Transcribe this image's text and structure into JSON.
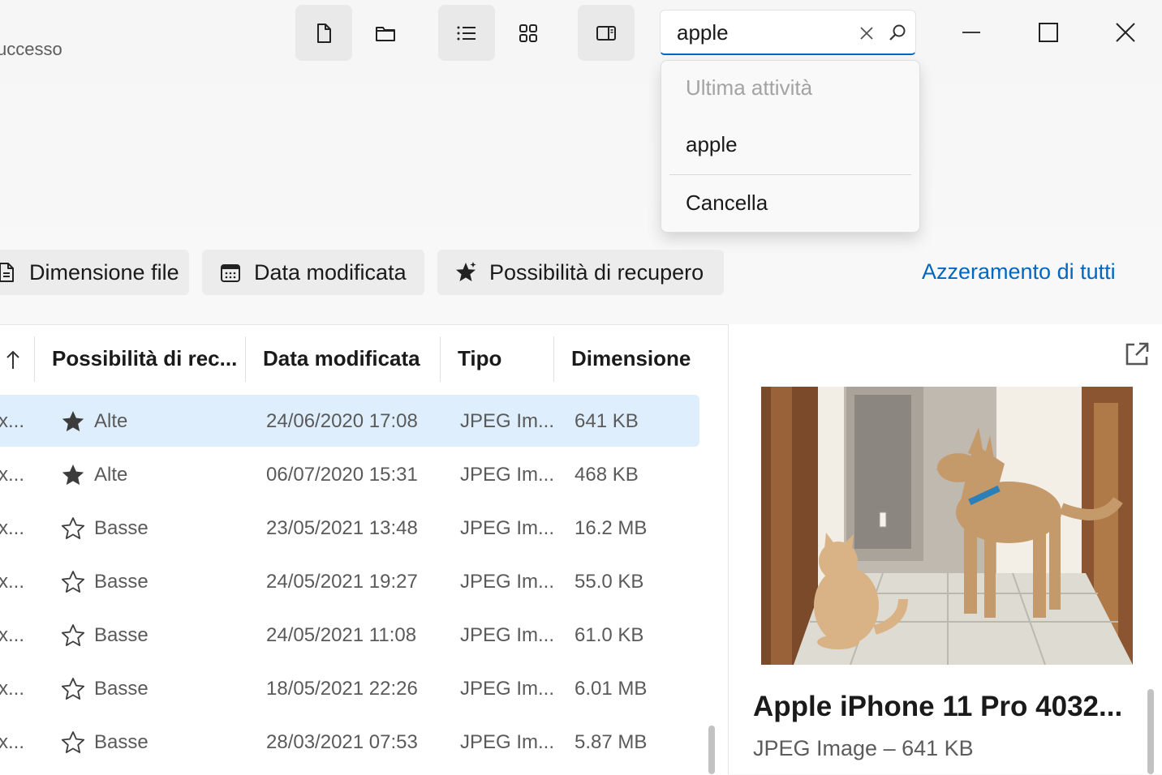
{
  "status": {
    "left_text": "uccesso"
  },
  "toolbar": {
    "file_icon": "file-icon",
    "folder_icon": "folder-icon",
    "list_icon": "list-view-icon",
    "grid_icon": "grid-view-icon",
    "pane_icon": "preview-pane-icon"
  },
  "search": {
    "value": "apple",
    "placeholder": ""
  },
  "dropdown": {
    "header": "Ultima attività",
    "items": [
      {
        "label": "apple"
      },
      {
        "label": "Cancella"
      }
    ]
  },
  "filters": {
    "chips": [
      {
        "label": "Dimensione file",
        "icon": "file-size-icon"
      },
      {
        "label": "Data modificata",
        "icon": "calendar-icon"
      },
      {
        "label": "Possibilità di recupero",
        "icon": "star-sparkle-icon"
      }
    ],
    "reset_label": "Azzeramento di tutti"
  },
  "table": {
    "columns": [
      {
        "label": "Possibilità di rec..."
      },
      {
        "label": "Data modificata"
      },
      {
        "label": "Tipo"
      },
      {
        "label": "Dimensione"
      }
    ],
    "rows": [
      {
        "name": "x...",
        "recovery": "Alte",
        "date": "24/06/2020 17:08",
        "type": "JPEG Im...",
        "size": "641 KB"
      },
      {
        "name": "x...",
        "recovery": "Alte",
        "date": "06/07/2020 15:31",
        "type": "JPEG Im...",
        "size": "468 KB"
      },
      {
        "name": "x...",
        "recovery": "Basse",
        "date": "23/05/2021 13:48",
        "type": "JPEG Im...",
        "size": "16.2 MB"
      },
      {
        "name": "x...",
        "recovery": "Basse",
        "date": "24/05/2021 19:27",
        "type": "JPEG Im...",
        "size": "55.0 KB"
      },
      {
        "name": "x...",
        "recovery": "Basse",
        "date": "24/05/2021 11:08",
        "type": "JPEG Im...",
        "size": "61.0 KB"
      },
      {
        "name": "x...",
        "recovery": "Basse",
        "date": "18/05/2021 22:26",
        "type": "JPEG Im...",
        "size": "6.01 MB"
      },
      {
        "name": "x...",
        "recovery": "Basse",
        "date": "28/03/2021 07:53",
        "type": "JPEG Im...",
        "size": "5.87 MB"
      }
    ]
  },
  "preview": {
    "title": "Apple iPhone 11 Pro 4032...",
    "subtitle": "JPEG Image – 641 KB"
  },
  "colors": {
    "accent": "#0067c0",
    "selected_row": "#dfeefc"
  }
}
